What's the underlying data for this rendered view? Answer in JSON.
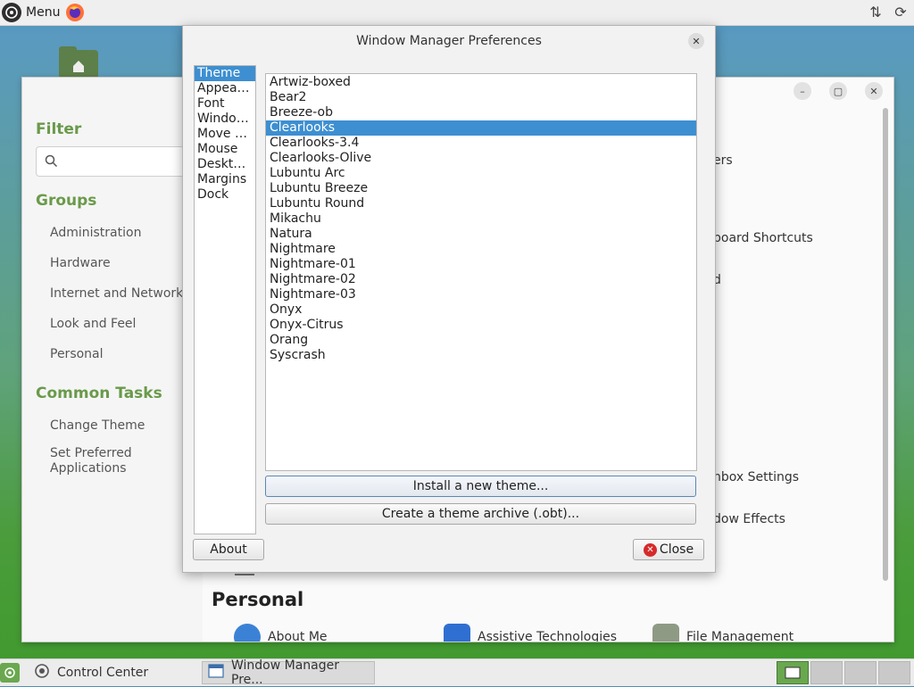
{
  "top_panel": {
    "menu_label": "Menu",
    "menu_icon": "lubuntu-logo-icon",
    "launcher_icon": "firefox-icon",
    "tray_icons": [
      "network-updown-icon",
      "update-notifier-icon"
    ]
  },
  "control_center": {
    "filter_heading": "Filter",
    "search_placeholder": "",
    "groups_heading": "Groups",
    "groups": [
      "Administration",
      "Hardware",
      "Internet and Network",
      "Look and Feel",
      "Personal"
    ],
    "common_tasks_heading": "Common Tasks",
    "tasks": [
      "Change Theme",
      "Set Preferred Applications"
    ],
    "visible_fragments": {
      "f1": "ers",
      "f2": "board Shortcuts",
      "f3": "d",
      "f4": "nbox Settings",
      "f5": "dow Effects"
    },
    "personal_heading": "Personal",
    "personal_items": [
      "About Me",
      "Assistive Technologies",
      "File Management"
    ]
  },
  "dialog": {
    "title": "Window Manager Preferences",
    "sections": [
      "Theme",
      "Appea…",
      "Font",
      "Windo…",
      "Move …",
      "Mouse",
      "Deskt…",
      "Margins",
      "Dock"
    ],
    "selected_section": "Theme",
    "themes": [
      "Artwiz-boxed",
      "Bear2",
      "Breeze-ob",
      "Clearlooks",
      "Clearlooks-3.4",
      "Clearlooks-Olive",
      "Lubuntu Arc",
      "Lubuntu Breeze",
      "Lubuntu Round",
      "Mikachu",
      "Natura",
      "Nightmare",
      "Nightmare-01",
      "Nightmare-02",
      "Nightmare-03",
      "Onyx",
      "Onyx-Citrus",
      "Orang",
      "Syscrash"
    ],
    "selected_theme": "Clearlooks",
    "install_button": "Install a new theme...",
    "archive_button": "Create a theme archive (.obt)...",
    "about_button": "About",
    "close_button": "Close"
  },
  "taskbar": {
    "tasks": [
      {
        "label": "Control Center",
        "icon": "control-center-icon"
      },
      {
        "label": "Window Manager Pre...",
        "icon": "window-icon"
      }
    ],
    "workspaces": 4,
    "active_workspace": 1,
    "colors": {
      "accent": "#3d8fd1",
      "brand": "#6aa84f"
    }
  }
}
